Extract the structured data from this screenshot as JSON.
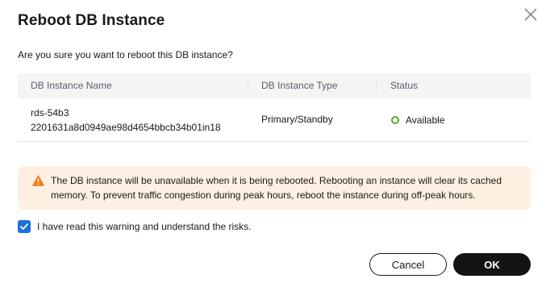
{
  "dialog": {
    "title": "Reboot DB Instance",
    "close_icon": "close-icon",
    "question": "Are you sure you want to reboot this DB instance?"
  },
  "table": {
    "headers": [
      "DB Instance Name",
      "DB Instance Type",
      "Status"
    ],
    "rows": [
      {
        "name_line1": "rds-54b3",
        "name_line2": "2201631a8d0949ae98d4654bbcb34b01in18",
        "type": "Primary/Standby",
        "status": "Available",
        "status_color": "#4caf2a"
      }
    ]
  },
  "warning": {
    "icon": "warning-icon",
    "color": "#f57c18",
    "background": "#fdf0e2",
    "text": "The DB instance will be unavailable when it is being rebooted. Rebooting an instance will clear its cached memory. To prevent traffic congestion during peak hours, reboot the instance during off-peak hours."
  },
  "confirm": {
    "checked": true,
    "label": "I have read this warning and understand the risks.",
    "accent": "#1f6fd9"
  },
  "buttons": {
    "cancel": "Cancel",
    "ok": "OK"
  }
}
